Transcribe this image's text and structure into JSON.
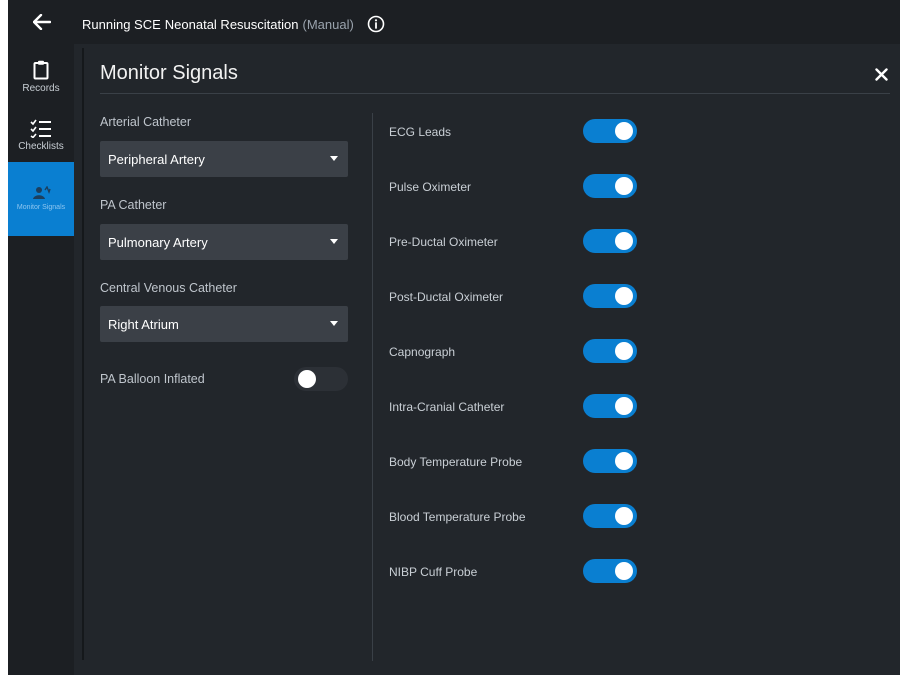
{
  "header": {
    "run_label": "Running SCE",
    "scenario_name": "Neonatal Resuscitation",
    "mode": "(Manual)"
  },
  "sidebar": {
    "items": [
      {
        "label": "Records",
        "icon": "clipboard-icon"
      },
      {
        "label": "Checklists",
        "icon": "checklist-icon"
      },
      {
        "label": "Monitor Signals",
        "icon": "monitor-signals-icon",
        "active": true
      }
    ]
  },
  "panel": {
    "title": "Monitor Signals"
  },
  "left_fields": {
    "arterial": {
      "label": "Arterial Catheter",
      "value": "Peripheral Artery"
    },
    "pa": {
      "label": "PA Catheter",
      "value": "Pulmonary Artery"
    },
    "cvc": {
      "label": "Central Venous Catheter",
      "value": "Right Atrium"
    },
    "balloon": {
      "label": "PA Balloon Inflated",
      "on": false
    }
  },
  "signals": [
    {
      "label": "ECG Leads",
      "on": true
    },
    {
      "label": "Pulse Oximeter",
      "on": true
    },
    {
      "label": "Pre-Ductal Oximeter",
      "on": true
    },
    {
      "label": "Post-Ductal Oximeter",
      "on": true
    },
    {
      "label": "Capnograph",
      "on": true
    },
    {
      "label": "Intra-Cranial Catheter",
      "on": true
    },
    {
      "label": "Body Temperature Probe",
      "on": true
    },
    {
      "label": "Blood Temperature Probe",
      "on": true
    },
    {
      "label": "NIBP Cuff Probe",
      "on": true
    }
  ],
  "colors": {
    "accent": "#0a7fd1",
    "background": "#22262b",
    "sidebar": "#1c1f23",
    "select_bg": "#3b4047"
  }
}
